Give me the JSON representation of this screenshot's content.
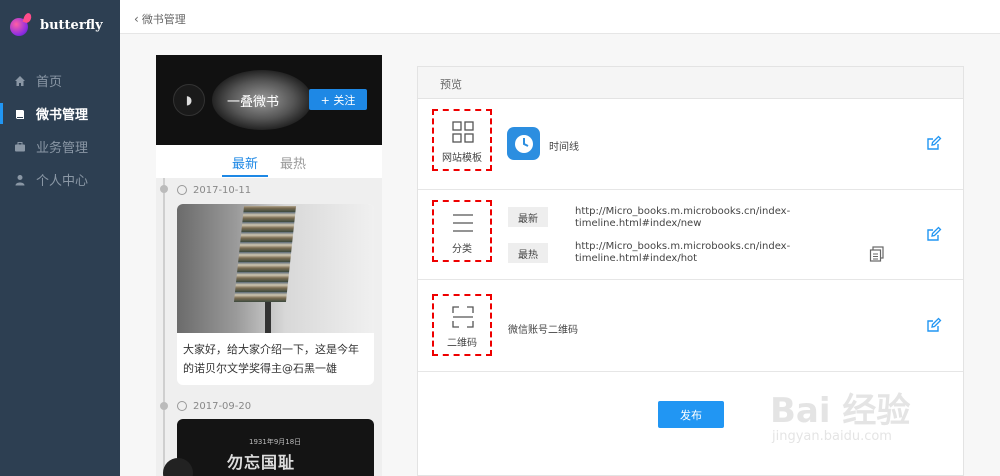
{
  "app": {
    "brand": "butterfly"
  },
  "sidebar": {
    "items": [
      {
        "label": "首页",
        "icon": "home-icon",
        "active": false
      },
      {
        "label": "微书管理",
        "icon": "book-icon",
        "active": true
      },
      {
        "label": "业务管理",
        "icon": "briefcase-icon",
        "active": false
      },
      {
        "label": "个人中心",
        "icon": "user-icon",
        "active": false
      }
    ]
  },
  "breadcrumb": {
    "back": "微书管理"
  },
  "phone": {
    "name": "一叠微书",
    "follow": "+ 关注",
    "tabs": [
      "最新",
      "最热"
    ],
    "posts": [
      {
        "date": "2017-10-11",
        "text": "大家好，给大家介绍一下，这是今年的诺贝尔文学奖得主@石黑一雄"
      },
      {
        "date": "2017-09-20",
        "poster_title": "勿忘国耻",
        "poster_sub": "1931年9月18日"
      }
    ]
  },
  "preview": {
    "title": "预览",
    "template": {
      "label": "网站模板",
      "value": "时间线"
    },
    "category": {
      "label": "分类",
      "items": [
        {
          "tag": "最新",
          "url": "http://Micro_books.m.microbooks.cn/index-timeline.html#index/new"
        },
        {
          "tag": "最热",
          "url": "http://Micro_books.m.microbooks.cn/index-timeline.html#index/hot"
        }
      ]
    },
    "qrcode": {
      "label": "二维码",
      "value": "微信账号二维码"
    },
    "publish": "发布"
  },
  "watermark": {
    "main": "Bai 经验",
    "sub": "jingyan.baidu.com"
  },
  "colors": {
    "sidebar": "#2d3f52",
    "accent": "#2196f3",
    "highlight_box": "#e00000"
  }
}
